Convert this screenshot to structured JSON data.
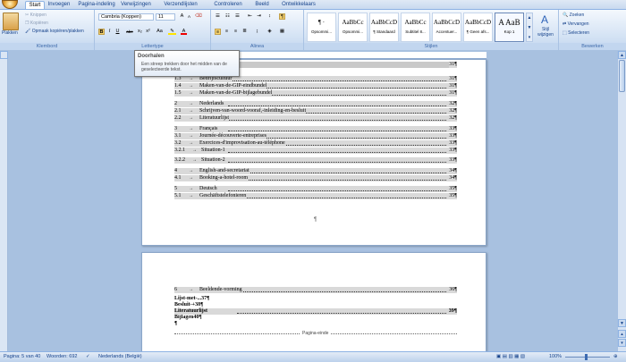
{
  "tabs": [
    "Start",
    "Invoegen",
    "Pagina-indeling",
    "Verwijzingen",
    "Verzendlijsten",
    "Controleren",
    "Beeld",
    "Ontwikkelaars"
  ],
  "clipboard": {
    "paste": "Plakken",
    "cut": "Knippen",
    "copy": "Kopiëren",
    "format_painter": "Opmaak kopiëren/plakken",
    "label": "Klembord"
  },
  "font": {
    "name": "Cambria (Koppen)",
    "size": "11",
    "label": "Lettertype",
    "buttons": [
      "B",
      "I",
      "U",
      "abe",
      "x₂",
      "x²",
      "Aa",
      "A"
    ]
  },
  "paragraph": {
    "label": "Alinea"
  },
  "styles": {
    "label": "Stijlen",
    "items": [
      {
        "preview": "¶ ·",
        "name": "Opsommi..."
      },
      {
        "preview": "AaBbCc",
        "name": "Opsommi..."
      },
      {
        "preview": "AaBbCcD",
        "name": "¶ Standaard"
      },
      {
        "preview": "AaBbCc",
        "name": "Subtitel 8..."
      },
      {
        "preview": "AaBbCcD",
        "name": "Accentuer..."
      },
      {
        "preview": "AaBbCcD",
        "name": "¶ Geen afs..."
      },
      {
        "preview": "A AaB",
        "name": "Kop 1"
      }
    ],
    "change": "Stijl wijzigen"
  },
  "editing": {
    "label": "Bewerken",
    "find": "Zoeken",
    "replace": "Vervangen",
    "select": "Selecteren"
  },
  "tooltip": {
    "title": "Doorhalen",
    "desc": "Een streep trekken door het midden van de geselecteerde tekst."
  },
  "page1": [
    {
      "n": "1.3",
      "t": "Bedrijfscultuur",
      "p": "31¶"
    },
    {
      "n": "1.4",
      "t": "Maken-van-de-GIP-eindbundel",
      "p": "31¶"
    },
    {
      "n": "1.5",
      "t": "Maken-van-de-GIP-bijlagebundel",
      "p": "31¶"
    },
    {
      "n": "2",
      "t": "Nederlands",
      "p": "32¶"
    },
    {
      "n": "2.1",
      "t": "Schrijven-van-woord-vooraf,-inleiding-en-besluit",
      "p": "32¶"
    },
    {
      "n": "2.2",
      "t": "Literatuurlijst",
      "p": "32¶"
    },
    {
      "n": "3",
      "t": "Français",
      "p": "33¶"
    },
    {
      "n": "3.1",
      "t": "Journée-découverte-entreprises",
      "p": "33¶"
    },
    {
      "n": "3.2",
      "t": "Exercices-d'improvisation-au-téléphone",
      "p": "33¶"
    },
    {
      "n": "3.2.1",
      "t": "Situation-1",
      "p": "33¶"
    },
    {
      "n": "3.2.2",
      "t": "Situation-2",
      "p": "33¶"
    },
    {
      "n": "4",
      "t": "English-and-secretariat",
      "p": "34¶"
    },
    {
      "n": "4.1",
      "t": "Booking-a-hotel-room",
      "p": "34¶"
    },
    {
      "n": "5",
      "t": "Deutsch",
      "p": "35¶"
    },
    {
      "n": "5.1",
      "t": "Geschäftstelefonieren",
      "p": "35¶"
    }
  ],
  "page2": [
    {
      "n": "6",
      "t": "Beeldende-vorming",
      "p": "36¶"
    }
  ],
  "page2_plain": [
    "Lijst-met-...37¶",
    "Besluit-+38¶",
    "Literatuurlijst",
    "Bijlagen40¶",
    "¶"
  ],
  "page2_lit_page": "39¶",
  "page_break": "Pagina-einde",
  "page1_para": "¶",
  "status": {
    "page": "Pagina: 5 van 40",
    "words": "Woorden: 692",
    "lang": "Nederlands (België)",
    "zoom": "100%"
  }
}
